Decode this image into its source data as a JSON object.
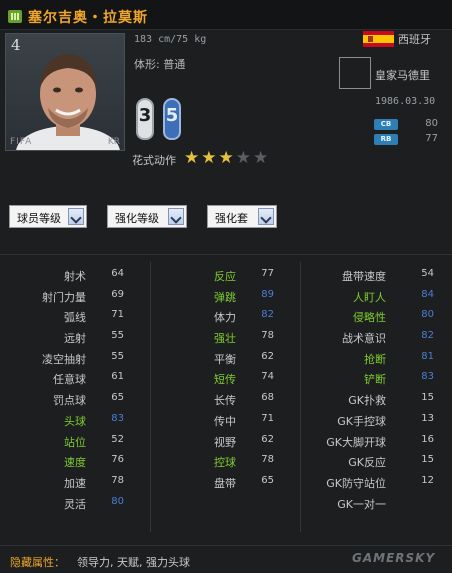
{
  "header": {
    "name": "塞尔吉奥・拉莫斯"
  },
  "portrait": {
    "number": "4",
    "watermark_left": "FIFA",
    "watermark_right": "KR"
  },
  "profile": {
    "height_weight": "183 cm/75 kg",
    "body_type": "体形: 普通",
    "left_foot": "3",
    "right_foot": "5",
    "skill_label": "花式动作",
    "skill_stars": 3,
    "skill_stars_max": 5
  },
  "nation": {
    "name": "西班牙"
  },
  "club": {
    "name": "皇家马德里"
  },
  "birthdate": "1986.03.30",
  "positions": [
    {
      "tag": "CB",
      "value": "80"
    },
    {
      "tag": "RB",
      "value": "77"
    }
  ],
  "dropdowns": [
    {
      "label": "球员等级"
    },
    {
      "label": "强化等级"
    },
    {
      "label": "强化套"
    }
  ],
  "colors": {
    "white": "#c8c8c8",
    "green": "#7fcc2e",
    "blue": "#4a7fd6",
    "orange": "#f0a62a"
  },
  "stats": {
    "col1": [
      {
        "name": "射术",
        "value": "64",
        "name_color": "white",
        "value_color": "white"
      },
      {
        "name": "射门力量",
        "value": "69",
        "name_color": "white",
        "value_color": "white"
      },
      {
        "name": "弧线",
        "value": "71",
        "name_color": "white",
        "value_color": "white"
      },
      {
        "name": "远射",
        "value": "55",
        "name_color": "white",
        "value_color": "white"
      },
      {
        "name": "凌空抽射",
        "value": "55",
        "name_color": "white",
        "value_color": "white"
      },
      {
        "name": "任意球",
        "value": "61",
        "name_color": "white",
        "value_color": "white"
      },
      {
        "name": "罚点球",
        "value": "65",
        "name_color": "white",
        "value_color": "white"
      },
      {
        "name": "头球",
        "value": "83",
        "name_color": "green",
        "value_color": "blue"
      },
      {
        "name": "站位",
        "value": "52",
        "name_color": "green",
        "value_color": "white"
      },
      {
        "name": "速度",
        "value": "76",
        "name_color": "green",
        "value_color": "white"
      },
      {
        "name": "加速",
        "value": "78",
        "name_color": "white",
        "value_color": "white"
      },
      {
        "name": "灵活",
        "value": "80",
        "name_color": "white",
        "value_color": "blue"
      }
    ],
    "col2": [
      {
        "name": "反应",
        "value": "77",
        "name_color": "green",
        "value_color": "white"
      },
      {
        "name": "弹跳",
        "value": "89",
        "name_color": "green",
        "value_color": "blue"
      },
      {
        "name": "体力",
        "value": "82",
        "name_color": "white",
        "value_color": "blue"
      },
      {
        "name": "强壮",
        "value": "78",
        "name_color": "green",
        "value_color": "white"
      },
      {
        "name": "平衡",
        "value": "62",
        "name_color": "white",
        "value_color": "white"
      },
      {
        "name": "短传",
        "value": "74",
        "name_color": "green",
        "value_color": "white"
      },
      {
        "name": "长传",
        "value": "68",
        "name_color": "white",
        "value_color": "white"
      },
      {
        "name": "传中",
        "value": "71",
        "name_color": "white",
        "value_color": "white"
      },
      {
        "name": "视野",
        "value": "62",
        "name_color": "white",
        "value_color": "white"
      },
      {
        "name": "控球",
        "value": "78",
        "name_color": "green",
        "value_color": "white"
      },
      {
        "name": "盘带",
        "value": "65",
        "name_color": "white",
        "value_color": "white"
      }
    ],
    "col3": [
      {
        "name": "盘带速度",
        "value": "54",
        "name_color": "white",
        "value_color": "white"
      },
      {
        "name": "人盯人",
        "value": "84",
        "name_color": "green",
        "value_color": "blue"
      },
      {
        "name": "侵略性",
        "value": "80",
        "name_color": "green",
        "value_color": "blue"
      },
      {
        "name": "战术意识",
        "value": "82",
        "name_color": "white",
        "value_color": "blue"
      },
      {
        "name": "抢断",
        "value": "81",
        "name_color": "green",
        "value_color": "blue"
      },
      {
        "name": "铲断",
        "value": "83",
        "name_color": "green",
        "value_color": "blue"
      },
      {
        "name": "GK扑救",
        "value": "15",
        "name_color": "white",
        "value_color": "white"
      },
      {
        "name": "GK手控球",
        "value": "13",
        "name_color": "white",
        "value_color": "white"
      },
      {
        "name": "GK大脚开球",
        "value": "16",
        "name_color": "white",
        "value_color": "white"
      },
      {
        "name": "GK反应",
        "value": "15",
        "name_color": "white",
        "value_color": "white"
      },
      {
        "name": "GK防守站位",
        "value": "12",
        "name_color": "white",
        "value_color": "white"
      },
      {
        "name": "GK一对一",
        "value": "",
        "name_color": "white",
        "value_color": "white"
      }
    ]
  },
  "hidden": {
    "label": "隐藏属性：",
    "value": "领导力, 天赋, 强力头球"
  },
  "watermark": {
    "text": "GAMERSKY"
  }
}
